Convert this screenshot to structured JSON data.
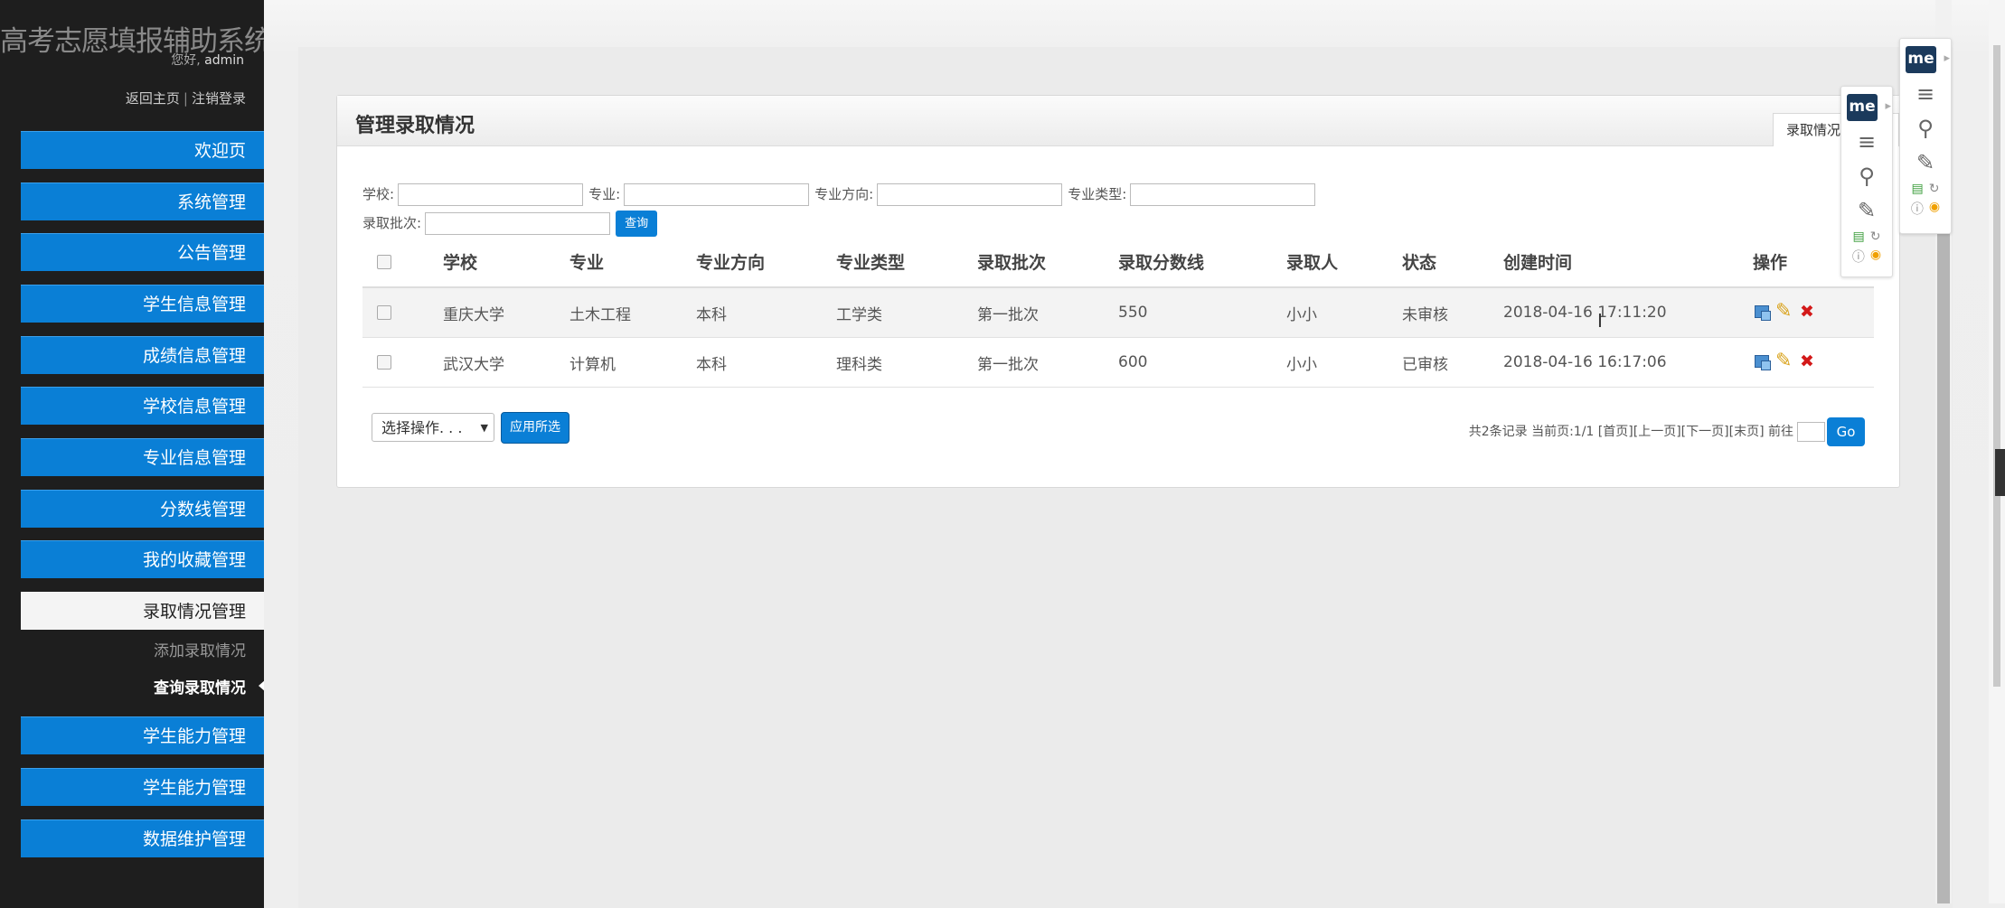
{
  "app": {
    "title": "高考志愿填报辅助系统",
    "greeting_prefix": "您好,",
    "username": "admin",
    "link_home": "返回主页",
    "link_logout": "注销登录"
  },
  "sidebar": {
    "items": [
      {
        "label": "欢迎页"
      },
      {
        "label": "系统管理"
      },
      {
        "label": "公告管理"
      },
      {
        "label": "学生信息管理"
      },
      {
        "label": "成绩信息管理"
      },
      {
        "label": "学校信息管理"
      },
      {
        "label": "专业信息管理"
      },
      {
        "label": "分数线管理"
      },
      {
        "label": "我的收藏管理"
      },
      {
        "label": "录取情况管理"
      },
      {
        "label": "学生能力管理"
      },
      {
        "label": "学生能力管理"
      },
      {
        "label": "数据维护管理"
      }
    ],
    "submenu": [
      {
        "label": "添加录取情况"
      },
      {
        "label": "查询录取情况"
      }
    ]
  },
  "panel": {
    "title": "管理录取情况",
    "tab_label": "录取情况"
  },
  "filters": {
    "school_label": "学校:",
    "major_label": "专业:",
    "direction_label": "专业方向:",
    "type_label": "专业类型:",
    "batch_label": "录取批次:",
    "query_button": "查询",
    "school_value": "",
    "major_value": "",
    "direction_value": "",
    "type_value": "",
    "batch_value": ""
  },
  "table": {
    "headers": [
      "学校",
      "专业",
      "专业方向",
      "专业类型",
      "录取批次",
      "录取分数线",
      "录取人",
      "状态",
      "创建时间",
      "操作"
    ],
    "rows": [
      [
        "重庆大学",
        "土木工程",
        "本科",
        "工学类",
        "第一批次",
        "550",
        "小小",
        "未审核",
        "2018-04-16 17:11:20"
      ],
      [
        "武汉大学",
        "计算机",
        "本科",
        "理科类",
        "第一批次",
        "600",
        "小小",
        "已审核",
        "2018-04-16 16:17:06"
      ]
    ]
  },
  "bulk": {
    "select_label": "选择操作. . .",
    "apply_button": "应用所选"
  },
  "pager": {
    "summary": "共2条记录 当前页:1/1",
    "first": "[首页]",
    "prev": "[上一页]",
    "next": "[下一页]",
    "last": "[末页]",
    "goto_label": "前往",
    "goto_value": "",
    "go_button": "Go"
  },
  "toolbar": {
    "logo_text": "me"
  },
  "colors": {
    "sidebar_bg": "#1e1e1e",
    "accent": "#0a7fd6",
    "danger": "#d31919"
  }
}
